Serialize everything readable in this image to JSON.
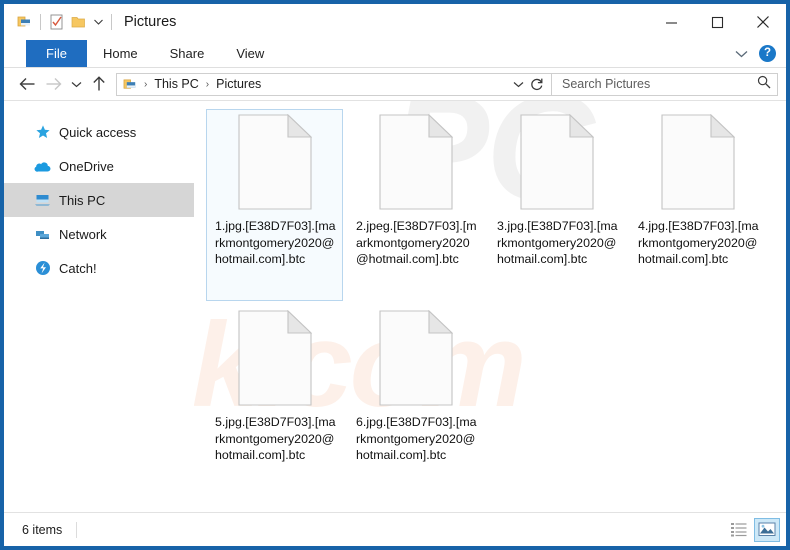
{
  "window": {
    "title": "Pictures",
    "accent_color": "#1763a8",
    "quick_access_icons": [
      "this-pc-icon",
      "properties-icon",
      "new-folder-icon",
      "customize-caret-icon"
    ],
    "caption": {
      "minimize": "minimize-icon",
      "maximize": "maximize-icon",
      "close": "close-icon"
    }
  },
  "ribbon": {
    "tabs": [
      {
        "label": "File",
        "active": true
      },
      {
        "label": "Home",
        "active": false
      },
      {
        "label": "Share",
        "active": false
      },
      {
        "label": "View",
        "active": false
      }
    ],
    "expand_label": "⌄",
    "help_label": "?"
  },
  "address": {
    "back": "←",
    "forward": "→",
    "recent": "⌄",
    "up": "↑",
    "breadcrumbs": [
      "This PC",
      "Pictures"
    ],
    "separator": "›",
    "refresh_icon": "refresh-icon"
  },
  "search": {
    "placeholder": "Search Pictures",
    "value": "",
    "icon": "search-icon"
  },
  "sidebar": {
    "items": [
      {
        "label": "Quick access",
        "icon": "star-icon",
        "selected": false
      },
      {
        "label": "OneDrive",
        "icon": "cloud-icon",
        "selected": false
      },
      {
        "label": "This PC",
        "icon": "monitor-icon",
        "selected": true
      },
      {
        "label": "Network",
        "icon": "network-icon",
        "selected": false
      },
      {
        "label": "Catch!",
        "icon": "catch-icon",
        "selected": false
      }
    ]
  },
  "watermark": {
    "top": "PC",
    "bottom": "risk.com"
  },
  "files": [
    {
      "name": "1.jpg.[E38D7F03].[markmontgomery2020@hotmail.com].btc",
      "icon": "generic-file-icon",
      "selected": true
    },
    {
      "name": "2.jpeg.[E38D7F03].[markmontgomery2020@hotmail.com].btc",
      "icon": "generic-file-icon",
      "selected": false
    },
    {
      "name": "3.jpg.[E38D7F03].[markmontgomery2020@hotmail.com].btc",
      "icon": "generic-file-icon",
      "selected": false
    },
    {
      "name": "4.jpg.[E38D7F03].[markmontgomery2020@hotmail.com].btc",
      "icon": "generic-file-icon",
      "selected": false
    },
    {
      "name": "5.jpg.[E38D7F03].[markmontgomery2020@hotmail.com].btc",
      "icon": "generic-file-icon",
      "selected": false
    },
    {
      "name": "6.jpg.[E38D7F03].[markmontgomery2020@hotmail.com].btc",
      "icon": "generic-file-icon",
      "selected": false
    }
  ],
  "status": {
    "item_count": "6 items",
    "views": [
      {
        "name": "details-view",
        "active": false
      },
      {
        "name": "large-icons-view",
        "active": true
      }
    ]
  }
}
